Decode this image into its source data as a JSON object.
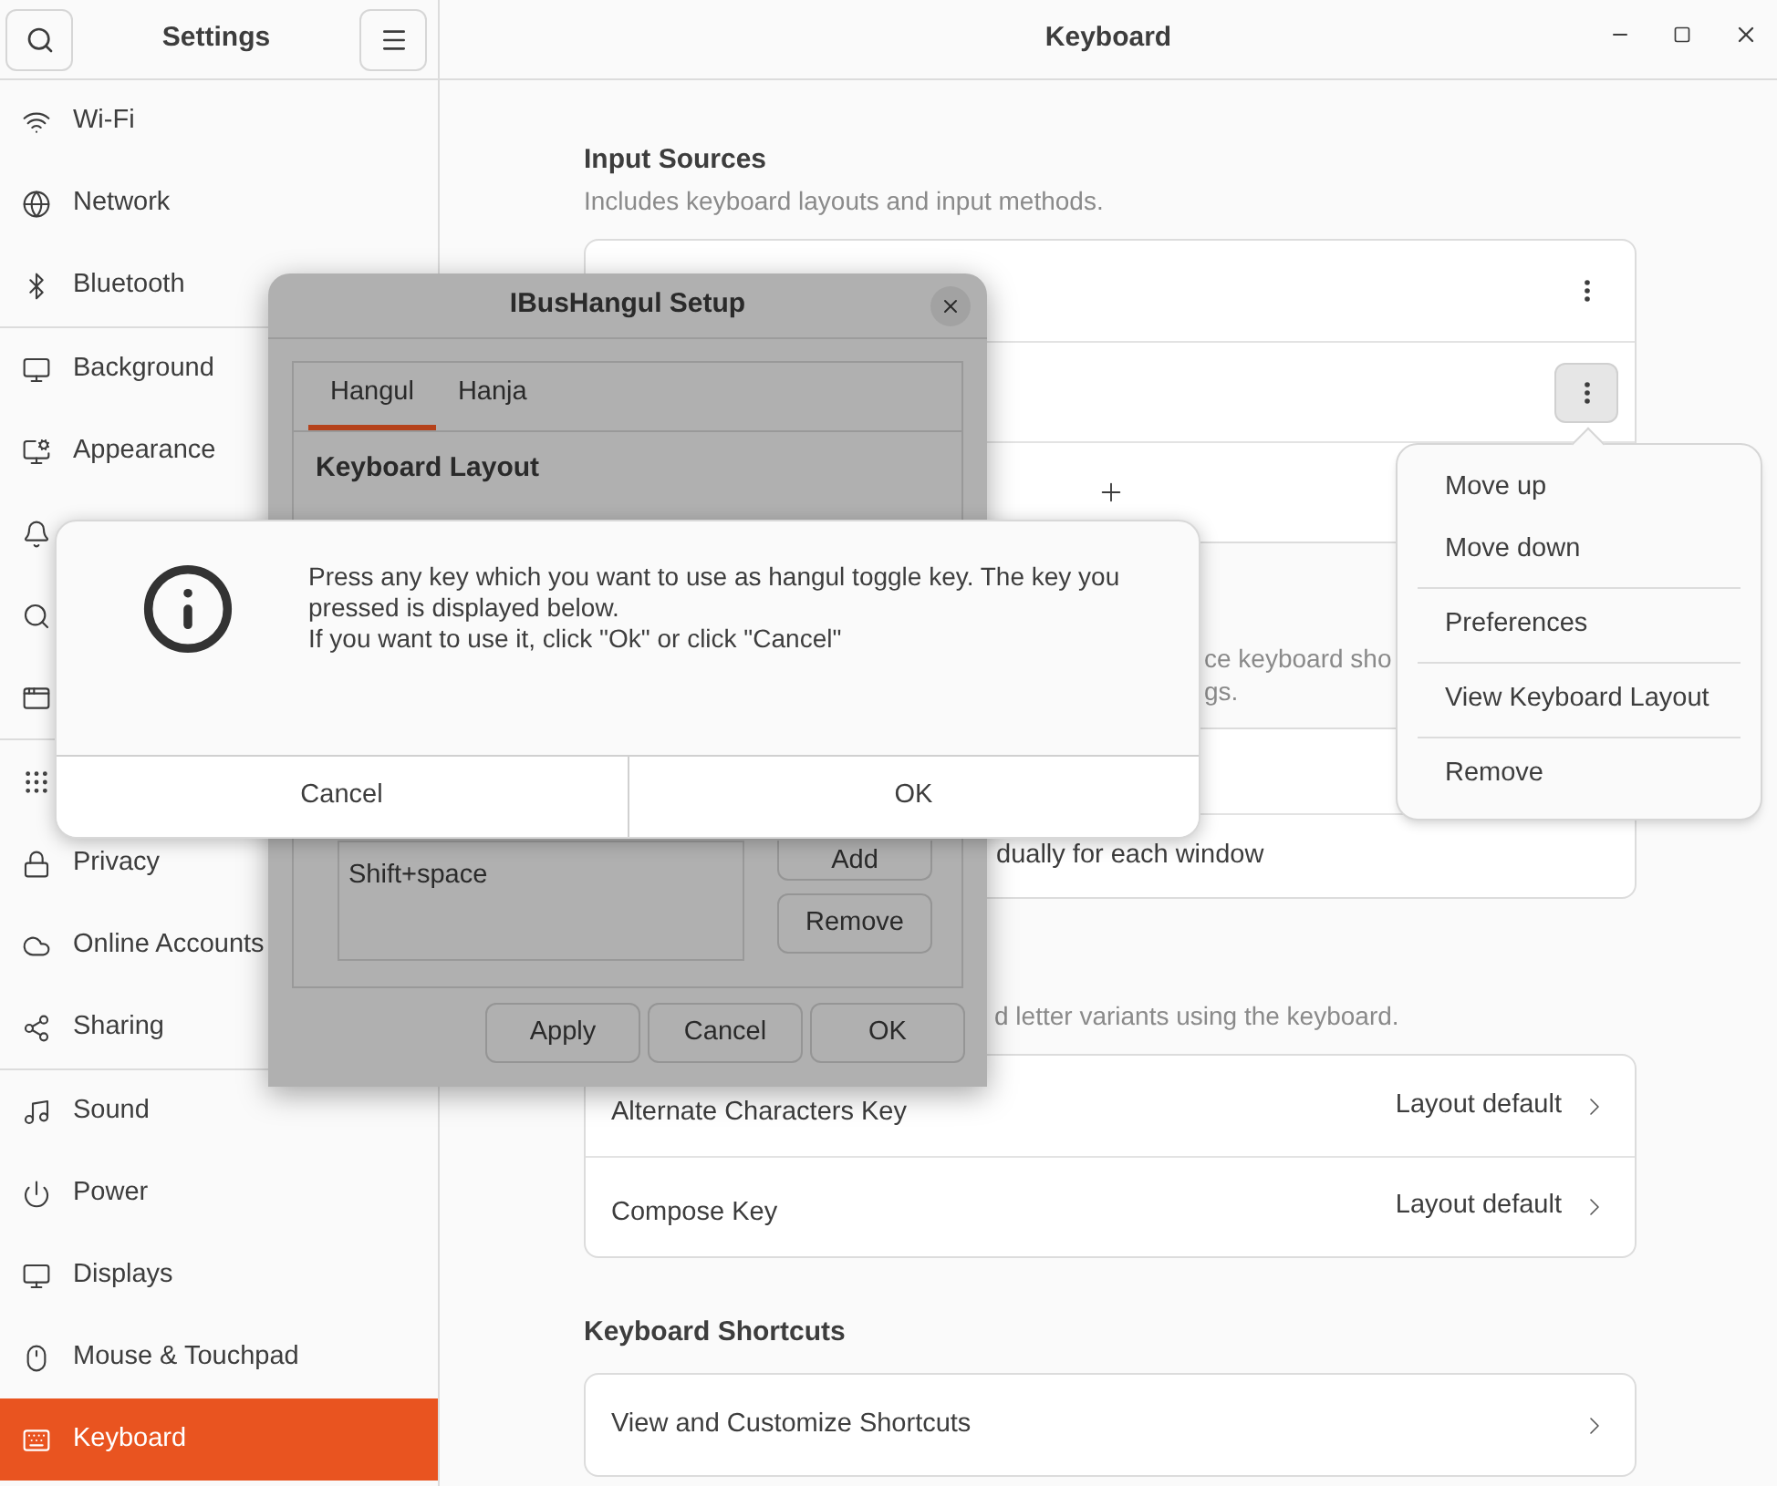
{
  "sidebar": {
    "title": "Settings",
    "groups": [
      [
        {
          "label": "Wi-Fi",
          "selected": false
        },
        {
          "label": "Network",
          "selected": false
        },
        {
          "label": "Bluetooth",
          "selected": false
        }
      ],
      [
        {
          "label": "Background",
          "selected": false
        },
        {
          "label": "Appearance",
          "selected": false
        },
        {
          "selected": false
        },
        {
          "selected": false
        },
        {
          "selected": false
        }
      ],
      [
        {
          "selected": false
        },
        {
          "label": "Privacy",
          "selected": false
        },
        {
          "label": "Online Accounts",
          "selected": false
        },
        {
          "label": "Sharing",
          "selected": false
        }
      ],
      [
        {
          "label": "Sound",
          "selected": false
        },
        {
          "label": "Power",
          "selected": false
        },
        {
          "label": "Displays",
          "selected": false
        },
        {
          "label": "Mouse & Touchpad",
          "selected": false
        },
        {
          "label": "Keyboard",
          "selected": true
        }
      ]
    ]
  },
  "main": {
    "title": "Keyboard",
    "input_sources": {
      "heading": "Input Sources",
      "subtitle": "Includes keyboard layouts and input methods.",
      "rows": [
        {
          "kind": "source",
          "menu_open": false
        },
        {
          "kind": "source",
          "menu_open": true
        },
        {
          "kind": "add"
        }
      ]
    },
    "switching": {
      "description": "ce keyboard sho\ngs.",
      "rows": [
        {
          "kind": "covered"
        },
        {
          "kind": "option",
          "label": "dually for each window"
        }
      ]
    },
    "special_characters": {
      "description": "d letter variants using the keyboard.",
      "rows": [
        {
          "label": "Alternate Characters Key",
          "value": "Layout default"
        },
        {
          "label": "Compose Key",
          "value": "Layout default"
        }
      ]
    },
    "shortcuts": {
      "heading": "Keyboard Shortcuts",
      "rows": [
        {
          "label": "View and Customize Shortcuts"
        }
      ]
    }
  },
  "popover_menu": {
    "sections": [
      [
        "Move up",
        "Move down"
      ],
      [
        "Preferences"
      ],
      [
        "View Keyboard Layout"
      ],
      [
        "Remove"
      ]
    ]
  },
  "ibus_dialog": {
    "title": "IBusHangul Setup",
    "tabs": [
      {
        "label": "Hangul",
        "selected": true
      },
      {
        "label": "Hanja",
        "selected": false
      }
    ],
    "section_heading": "Keyboard Layout",
    "toggle_keys": [
      "Shift+space"
    ],
    "side_buttons": [
      "Add",
      "Remove"
    ],
    "buttons": [
      "Apply",
      "Cancel",
      "OK"
    ]
  },
  "message_dialog": {
    "message": "Press any key which you want to use as hangul toggle key. The key you\npressed is displayed below.\nIf you want to use it, click \"Ok\" or click \"Cancel\"",
    "buttons": [
      "Cancel",
      "OK"
    ]
  }
}
